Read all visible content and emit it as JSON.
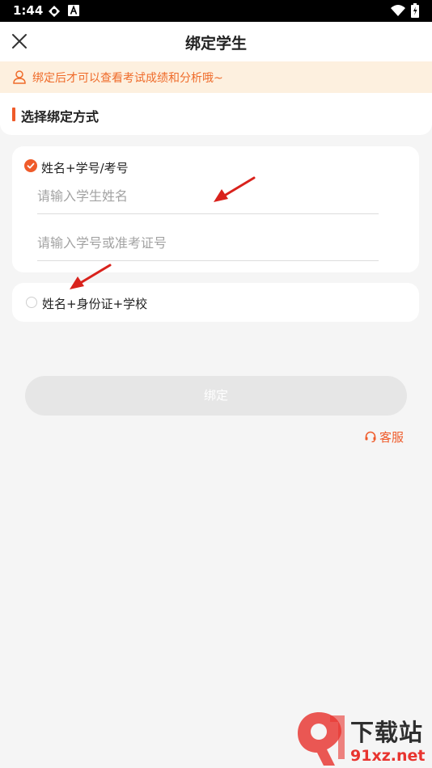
{
  "status_bar": {
    "time": "1:44",
    "icons": [
      "sync-icon",
      "a-badge-icon",
      "wifi-icon",
      "battery-icon"
    ]
  },
  "app_bar": {
    "title": "绑定学生",
    "close_icon": "close-icon"
  },
  "notice": {
    "icon": "user-icon",
    "text": "绑定后才可以查看考试成绩和分析哦~",
    "color": "#ef6b2a"
  },
  "section": {
    "title": "选择绑定方式"
  },
  "options": [
    {
      "label": "姓名+学号/考号",
      "selected": true,
      "fields": [
        {
          "placeholder": "请输入学生姓名",
          "value": ""
        },
        {
          "placeholder": "请输入学号或准考证号",
          "value": ""
        }
      ]
    },
    {
      "label": "姓名+身份证+学校",
      "selected": false
    }
  ],
  "bind_button": {
    "label": "绑定",
    "enabled": false
  },
  "service_link": {
    "icon": "headset-icon",
    "label": "客服"
  },
  "watermark": {
    "title": "下载站",
    "url": "91xz.net"
  },
  "colors": {
    "accent": "#ef5b2a",
    "notice_bg": "#fdf0df",
    "page_bg": "#f5f5f5",
    "annotation_arrow": "#d9221c"
  }
}
